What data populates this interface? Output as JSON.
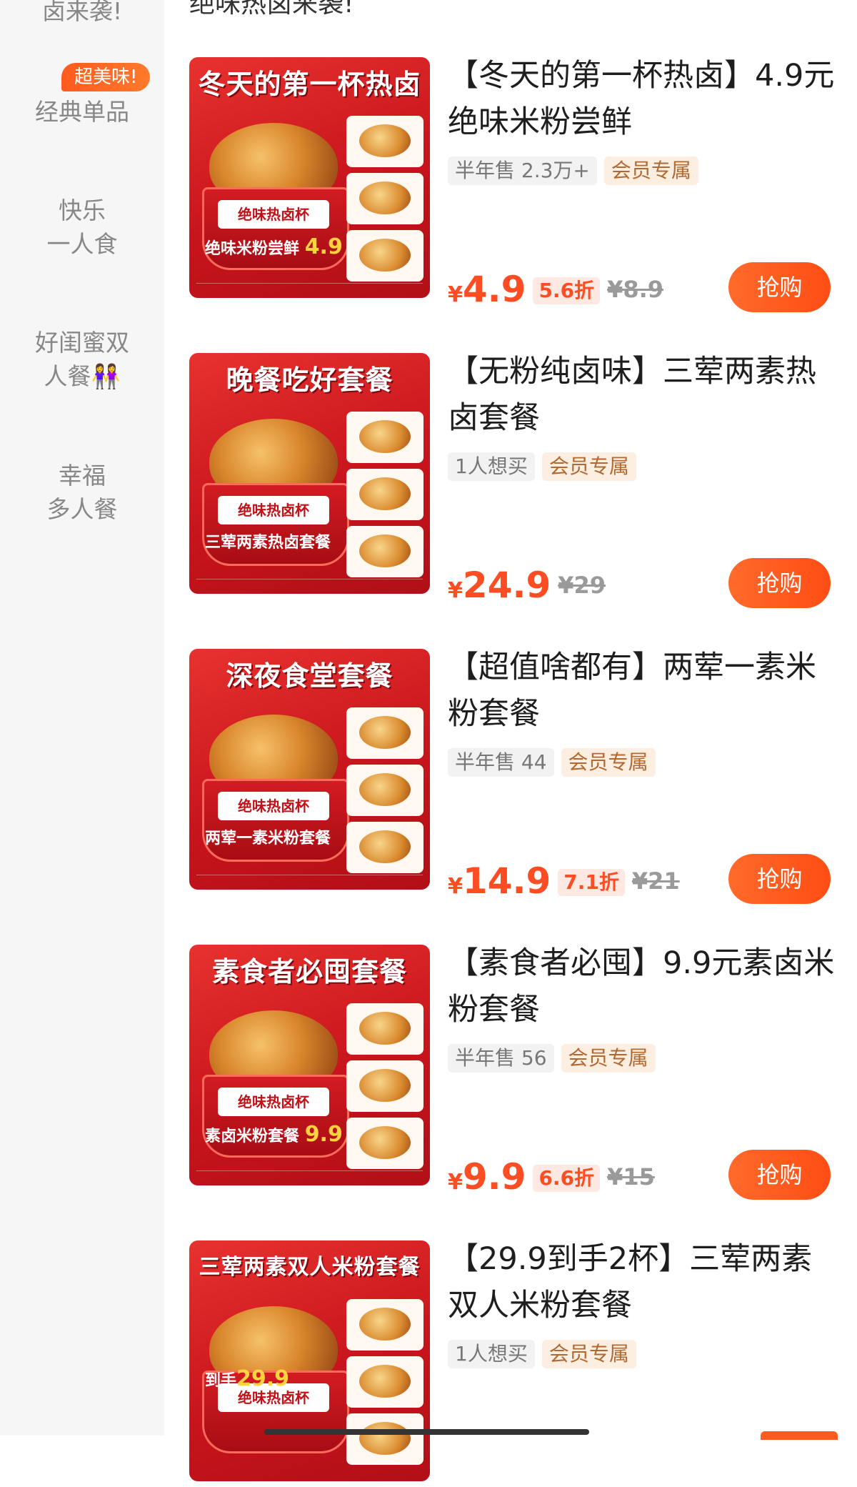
{
  "sidebar": {
    "top_cut": "卤来袭!",
    "badge": "超美味!",
    "items": [
      {
        "line1": "经典单品",
        "line2": ""
      },
      {
        "line1": "快乐",
        "line2": "一人食"
      },
      {
        "line1": "好闺蜜双",
        "line2": "人餐👭"
      },
      {
        "line1": "幸福",
        "line2": "多人餐"
      }
    ]
  },
  "header_cut": "绝味热卤来袭!",
  "buy_label": "抢购",
  "products": [
    {
      "title": "【冬天的第一杯热卤】4.9元绝味米粉尝鲜",
      "sales": "半年售 2.3万+",
      "member": "会员专属",
      "currency": "¥",
      "price": "4.9",
      "discount": "5.6折",
      "original": "¥8.9",
      "image_banner": "冬天的第一杯热卤",
      "image_cup": "绝味热卤杯",
      "image_tag": "绝味米粉尝鲜",
      "image_tag_num": "4.9"
    },
    {
      "title": "【无粉纯卤味】三荤两素热卤套餐",
      "sales": "1人想买",
      "member": "会员专属",
      "currency": "¥",
      "price": "24.9",
      "discount": "",
      "original": "¥29",
      "image_banner": "晚餐吃好套餐",
      "image_cup": "绝味热卤杯",
      "image_tag": "三荤两素热卤套餐",
      "image_tag_num": ""
    },
    {
      "title": "【超值啥都有】两荤一素米粉套餐",
      "sales": "半年售 44",
      "member": "会员专属",
      "currency": "¥",
      "price": "14.9",
      "discount": "7.1折",
      "original": "¥21",
      "image_banner": "深夜食堂套餐",
      "image_cup": "绝味热卤杯",
      "image_tag": "两荤一素米粉套餐",
      "image_tag_num": ""
    },
    {
      "title": "【素食者必囤】9.9元素卤米粉套餐",
      "sales": "半年售 56",
      "member": "会员专属",
      "currency": "¥",
      "price": "9.9",
      "discount": "6.6折",
      "original": "¥15",
      "image_banner": "素食者必囤套餐",
      "image_cup": "绝味热卤杯",
      "image_tag": "素卤米粉套餐",
      "image_tag_num": "9.9"
    },
    {
      "title": "【29.9到手2杯】三荤两素双人米粉套餐",
      "sales": "1人想买",
      "member": "会员专属",
      "currency": "",
      "price": "",
      "discount": "",
      "original": "",
      "image_banner": "三荤两素双人米粉套餐",
      "image_cup": "绝味热卤杯",
      "image_tag": "到手",
      "image_tag_num": "29.9"
    }
  ]
}
